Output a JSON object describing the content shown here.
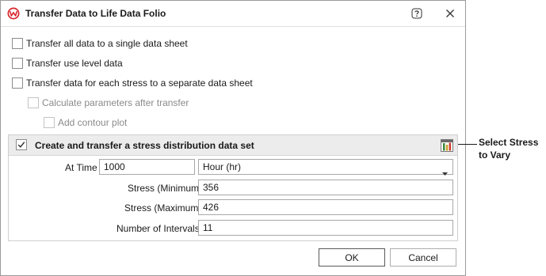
{
  "dialog": {
    "title": "Transfer Data to Life Data Folio",
    "help_icon": "help-icon",
    "close_icon": "close-icon",
    "app_icon": "weibull-logo-icon"
  },
  "options": [
    {
      "label": "Transfer all data to a single data sheet",
      "checked": false,
      "enabled": true
    },
    {
      "label": "Transfer use level data",
      "checked": false,
      "enabled": true
    },
    {
      "label": "Transfer data for each stress to a separate data sheet",
      "checked": false,
      "enabled": true
    },
    {
      "label": "Calculate parameters after transfer",
      "checked": false,
      "enabled": false
    },
    {
      "label": "Add contour plot",
      "checked": false,
      "enabled": false
    }
  ],
  "stress_panel": {
    "checked": true,
    "title": "Create and transfer a stress distribution data set",
    "icon": "select-stress-icon",
    "at_time_label": "At Time",
    "at_time_value": "1000",
    "time_unit": "Hour (hr)",
    "stress_min_label": "Stress (Minimum)",
    "stress_min_value": "356",
    "stress_max_label": "Stress (Maximum)",
    "stress_max_value": "426",
    "intervals_label": "Number of Intervals",
    "intervals_value": "11"
  },
  "buttons": {
    "ok": "OK",
    "cancel": "Cancel"
  },
  "callout": {
    "text": "Select Stress to Vary"
  },
  "colors": {
    "brand_red": "#d8262d",
    "panel_header_bg": "#ececec"
  }
}
